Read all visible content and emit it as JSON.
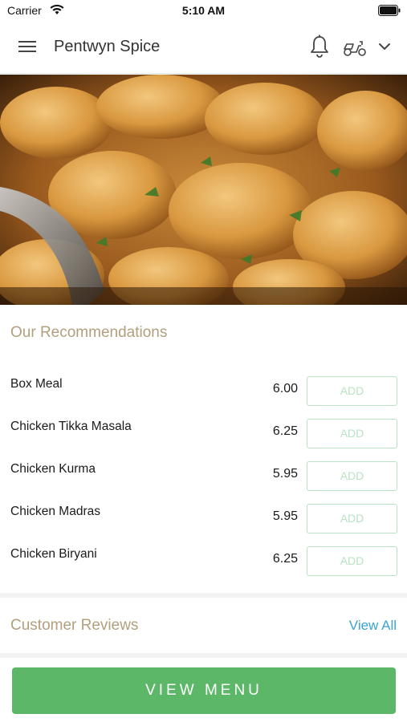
{
  "status_bar": {
    "carrier": "Carrier",
    "time": "5:10 AM"
  },
  "header": {
    "title": "Pentwyn Spice",
    "icons": [
      "menu-icon",
      "bell-icon",
      "scooter-icon",
      "chevron-down-icon"
    ]
  },
  "hero": {
    "icon": "food-photo"
  },
  "recommendations": {
    "title": "Our Recommendations",
    "items": [
      {
        "name": "Box Meal",
        "price": "6.00",
        "button": "ADD"
      },
      {
        "name": "Chicken Tikka Masala",
        "price": "6.25",
        "button": "ADD"
      },
      {
        "name": "Chicken Kurma",
        "price": "5.95",
        "button": "ADD"
      },
      {
        "name": "Chicken Madras",
        "price": "5.95",
        "button": "ADD"
      },
      {
        "name": "Chicken Biryani",
        "price": "6.25",
        "button": "ADD"
      }
    ]
  },
  "reviews": {
    "title": "Customer Reviews",
    "view_all": "View All"
  },
  "footer": {
    "view_menu": "VIEW MENU"
  },
  "colors": {
    "accent_green": "#5cb868",
    "add_border": "#b9e3c3",
    "section_title": "#b29f7d",
    "link_blue": "#3aa3d1"
  }
}
